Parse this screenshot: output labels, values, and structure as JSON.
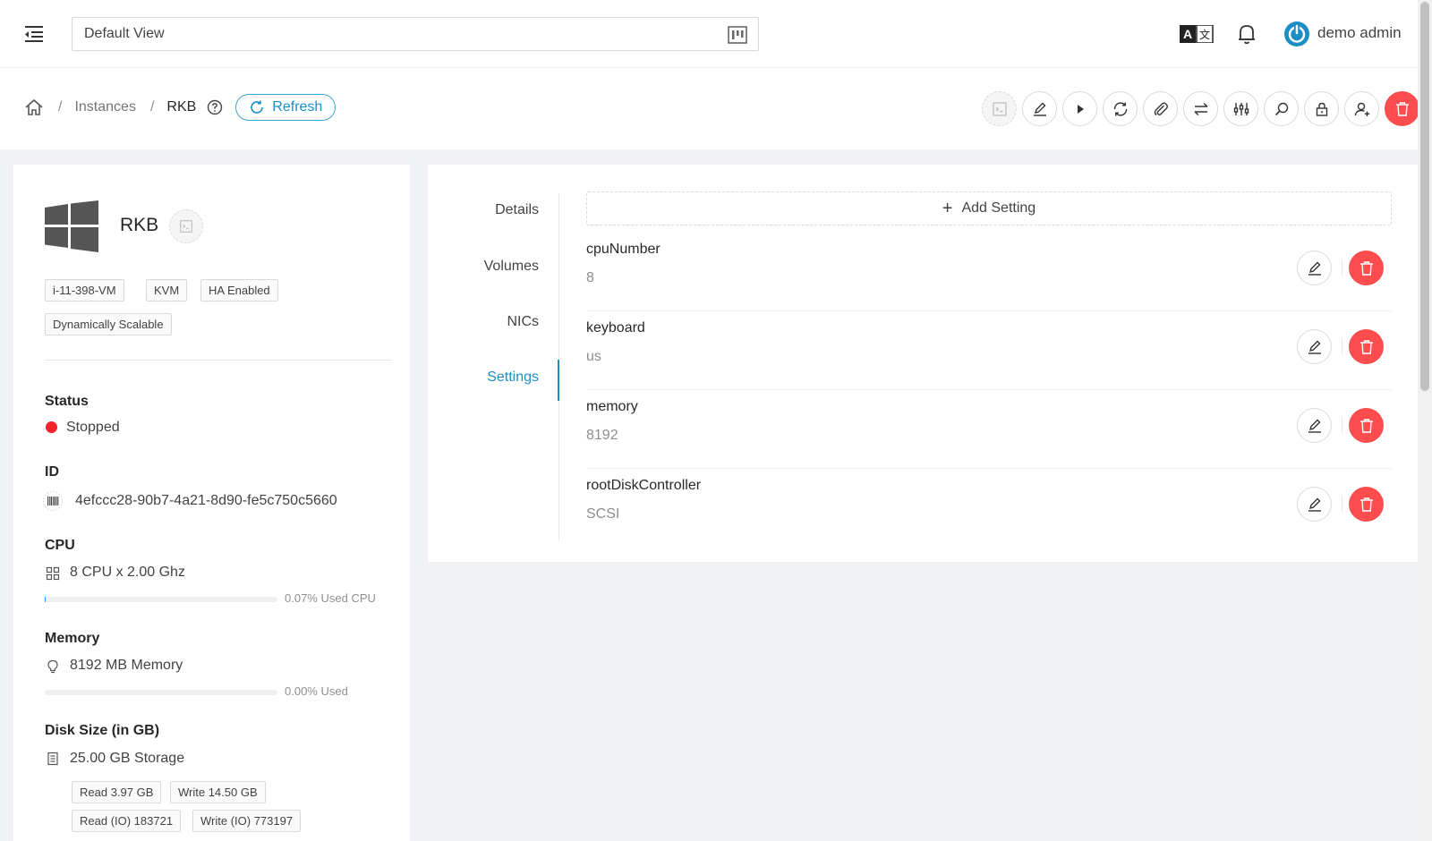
{
  "topbar": {
    "view_select_value": "Default View",
    "user_name": "demo admin"
  },
  "breadcrumb": {
    "items": [
      "Instances",
      "RKB"
    ],
    "refresh_label": "Refresh"
  },
  "vm": {
    "name": "RKB",
    "tags": [
      "i-11-398-VM",
      "KVM",
      "HA Enabled",
      "Dynamically Scalable"
    ],
    "status_title": "Status",
    "status_value": "Stopped",
    "id_title": "ID",
    "id_value": "4efccc28-90b7-4a21-8d90-fe5c750c5660",
    "cpu_title": "CPU",
    "cpu_value": "8 CPU x 2.00 Ghz",
    "cpu_used_label": "0.07% Used CPU",
    "cpu_used_fraction": 0.0007,
    "memory_title": "Memory",
    "memory_value": "8192 MB Memory",
    "memory_used_label": "0.00% Used",
    "memory_used_fraction": 0,
    "disk_title": "Disk Size (in GB)",
    "disk_value": "25.00 GB Storage",
    "disk_tags": [
      "Read 3.97 GB",
      "Write 14.50 GB",
      "Read (IO) 183721",
      "Write (IO) 773197"
    ]
  },
  "tabs": [
    "Details",
    "Volumes",
    "NICs",
    "Settings"
  ],
  "active_tab": "Settings",
  "settings": {
    "add_label": "Add Setting",
    "rows": [
      {
        "name": "cpuNumber",
        "value": "8"
      },
      {
        "name": "keyboard",
        "value": "us"
      },
      {
        "name": "memory",
        "value": "8192"
      },
      {
        "name": "rootDiskController",
        "value": "SCSI"
      }
    ]
  },
  "colors": {
    "accent": "#1b8fc4",
    "danger": "#ff4d4f",
    "status_stopped": "#f5222d"
  }
}
